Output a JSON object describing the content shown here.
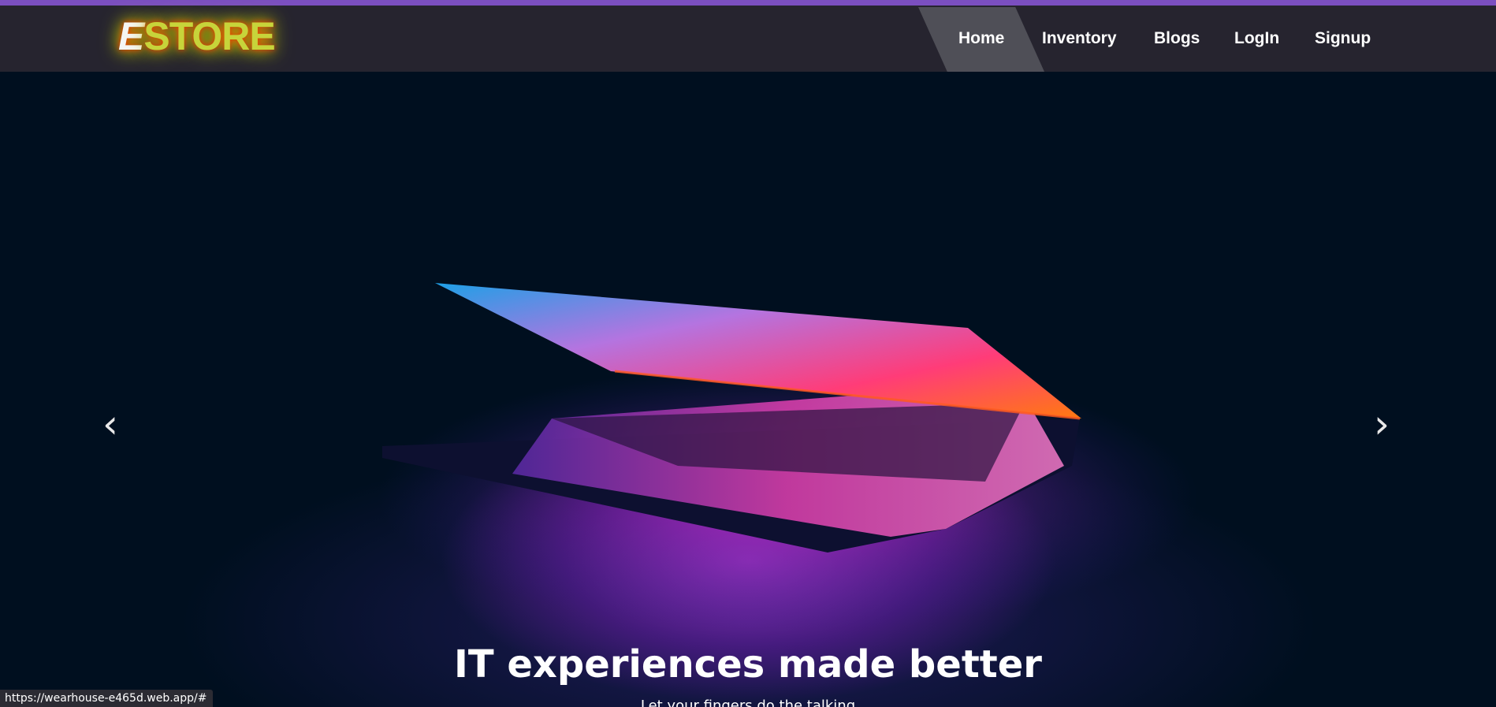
{
  "brand": {
    "first_letter": "E",
    "rest": "STORE"
  },
  "nav": {
    "items": [
      {
        "label": "Home",
        "active": true
      },
      {
        "label": "Inventory"
      },
      {
        "label": "Blogs"
      },
      {
        "label": "LogIn"
      },
      {
        "label": "Signup"
      }
    ]
  },
  "hero": {
    "title": "IT experiences made better",
    "subtitle": "Let your fingers do the talking",
    "prev_icon": "chevron-left-icon",
    "next_icon": "chevron-right-icon"
  },
  "status_bar": {
    "url": "https://wearhouse-e465d.web.app/#"
  },
  "colors": {
    "top_strip": "#7b4fc0",
    "navbar": "#26242f",
    "active_nav": "#4f4f57",
    "hero_background": "#000f1f"
  }
}
